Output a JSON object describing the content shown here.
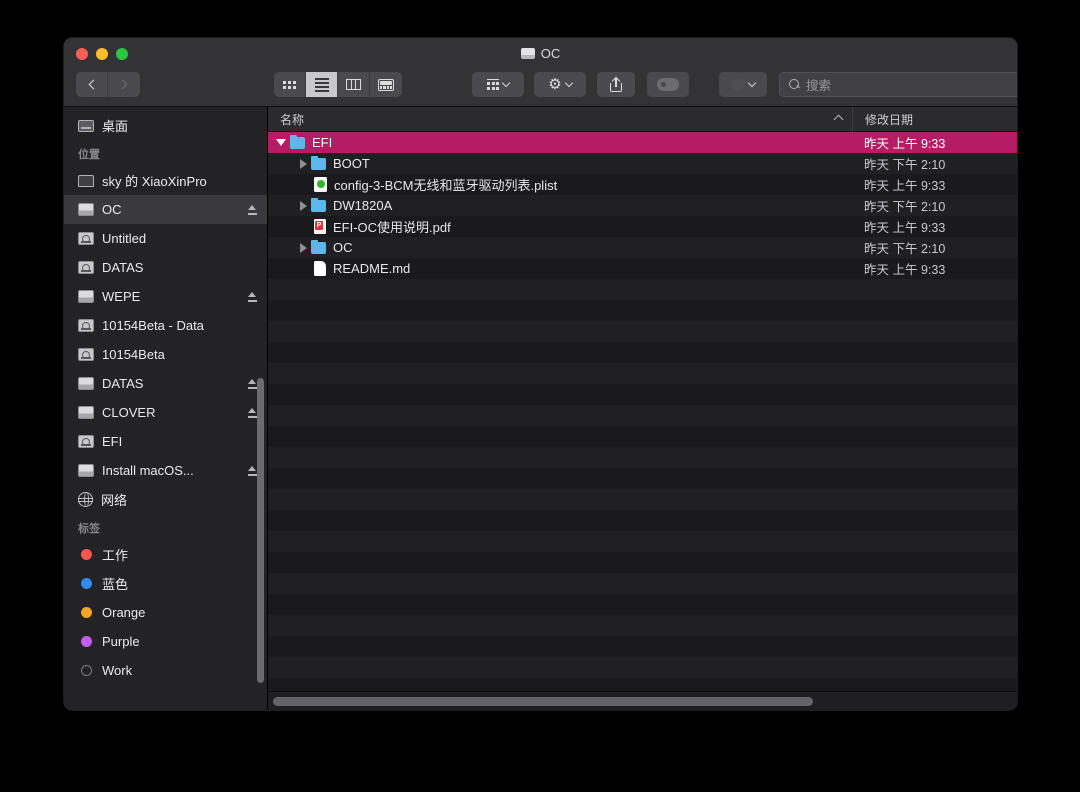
{
  "window": {
    "title": "OC",
    "title_icon": "drive-icon",
    "traffic_lights": [
      {
        "name": "close-button",
        "color": "#ff5f57"
      },
      {
        "name": "minimize-button",
        "color": "#febc2e"
      },
      {
        "name": "maximize-button",
        "color": "#28c840"
      }
    ]
  },
  "toolbar": {
    "back_label": "Back",
    "forward_label": "Forward",
    "view_modes": [
      {
        "name": "icon-view-button",
        "icon": "grid-icon",
        "active": false
      },
      {
        "name": "list-view-button",
        "icon": "list-icon",
        "active": true
      },
      {
        "name": "column-view-button",
        "icon": "columns-icon",
        "active": false
      },
      {
        "name": "gallery-view-button",
        "icon": "gallery-icon",
        "active": false
      }
    ],
    "arrange_label": "",
    "action_label": "",
    "share_label": "",
    "tag_label": ""
  },
  "search": {
    "placeholder": "搜索",
    "value": ""
  },
  "sidebar": {
    "top_items": [
      {
        "label": "桌面",
        "icon": "desktop-icon",
        "eject": false
      }
    ],
    "locations_header": "位置",
    "locations": [
      {
        "label": "sky 的 XiaoXinPro",
        "icon": "laptop-icon",
        "eject": false,
        "selected": false
      },
      {
        "label": "OC",
        "icon": "drive-icon",
        "eject": true,
        "selected": true
      },
      {
        "label": "Untitled",
        "icon": "hdd-icon",
        "eject": false,
        "selected": false
      },
      {
        "label": "DATAS",
        "icon": "hdd-icon",
        "eject": false,
        "selected": false
      },
      {
        "label": "WEPE",
        "icon": "drive-icon",
        "eject": true,
        "selected": false
      },
      {
        "label": "10154Beta - Data",
        "icon": "hdd-icon",
        "eject": false,
        "selected": false
      },
      {
        "label": "10154Beta",
        "icon": "hdd-icon",
        "eject": false,
        "selected": false
      },
      {
        "label": "DATAS",
        "icon": "drive-icon",
        "eject": true,
        "selected": false
      },
      {
        "label": "CLOVER",
        "icon": "drive-icon",
        "eject": true,
        "selected": false
      },
      {
        "label": "EFI",
        "icon": "hdd-icon",
        "eject": false,
        "selected": false
      },
      {
        "label": "Install macOS...",
        "icon": "drive-icon",
        "eject": true,
        "selected": false
      },
      {
        "label": "网络",
        "icon": "network-icon",
        "eject": false,
        "selected": false
      }
    ],
    "tags_header": "标签",
    "tags": [
      {
        "label": "工作",
        "color": "#f5564f"
      },
      {
        "label": "蓝色",
        "color": "#2e8bf5"
      },
      {
        "label": "Orange",
        "color": "#f5a623"
      },
      {
        "label": "Purple",
        "color": "#c45ef0"
      },
      {
        "label": "Work",
        "color": "hollow"
      }
    ]
  },
  "filelist": {
    "columns": [
      {
        "label": "名称",
        "sort": "asc"
      },
      {
        "label": "修改日期",
        "sort": null
      }
    ],
    "rows": [
      {
        "name": "EFI",
        "icon": "folder-icon",
        "twisty": "open",
        "indent": 0,
        "date": "昨天 上午 9:33",
        "selected": true
      },
      {
        "name": "BOOT",
        "icon": "folder-icon",
        "twisty": "closed",
        "indent": 1,
        "date": "昨天 下午 2:10",
        "selected": false
      },
      {
        "name": "config-3-BCM无线和蓝牙驱动列表.plist",
        "icon": "plist-icon",
        "twisty": "none",
        "indent": 1,
        "date": "昨天 上午 9:33",
        "selected": false
      },
      {
        "name": "DW1820A",
        "icon": "folder-icon",
        "twisty": "closed",
        "indent": 1,
        "date": "昨天 下午 2:10",
        "selected": false
      },
      {
        "name": "EFI-OC使用说明.pdf",
        "icon": "pdf-icon",
        "twisty": "none",
        "indent": 1,
        "date": "昨天 上午 9:33",
        "selected": false
      },
      {
        "name": "OC",
        "icon": "folder-icon",
        "twisty": "closed",
        "indent": 1,
        "date": "昨天 下午 2:10",
        "selected": false
      },
      {
        "name": "README.md",
        "icon": "doc-icon",
        "twisty": "none",
        "indent": 1,
        "date": "昨天 上午 9:33",
        "selected": false
      }
    ],
    "empty_rows": 20
  },
  "colors": {
    "selection": "#b61c64",
    "toolbar_bg": "#333336",
    "sidebar_bg": "#232326",
    "list_bg": "#1a1a1c",
    "list_alt_bg": "#202023"
  }
}
